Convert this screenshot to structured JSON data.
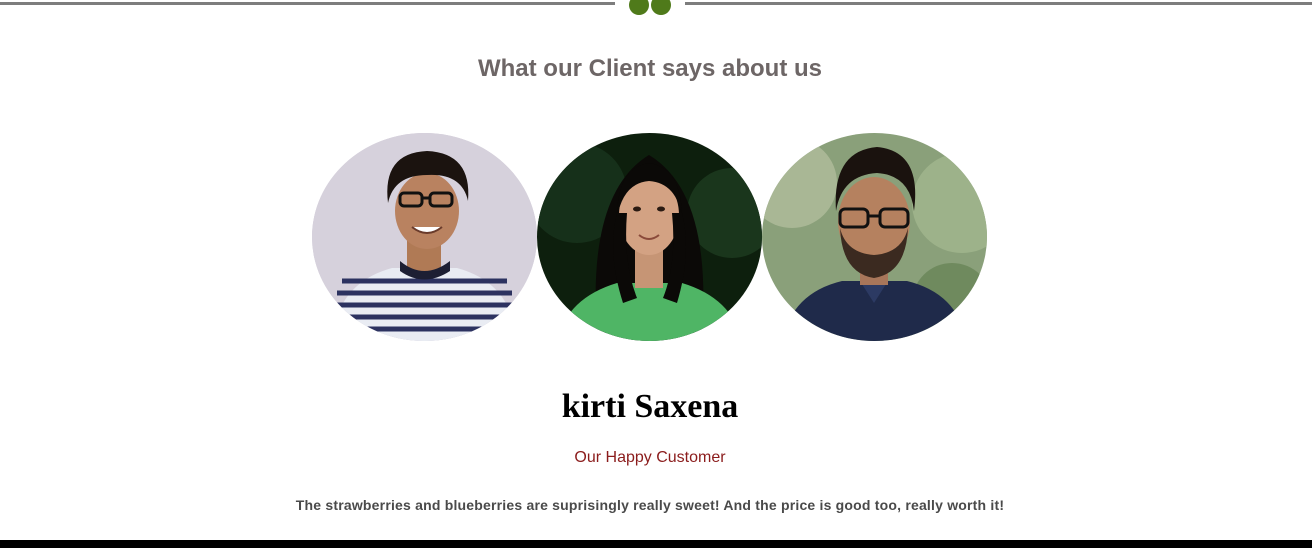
{
  "testimonials": {
    "heading": "What our Client says about us",
    "accent_color": "#4f7a1a",
    "quote_icon": "quote-icon",
    "clients": [
      {
        "label": "client-avatar-1"
      },
      {
        "label": "client-avatar-2"
      },
      {
        "label": "client-avatar-3"
      }
    ],
    "active": {
      "name": "kirti Saxena",
      "role": "Our Happy Customer",
      "quote": "The strawberries and blueberries are suprisingly really sweet! And the price is good too, really worth it!"
    }
  }
}
